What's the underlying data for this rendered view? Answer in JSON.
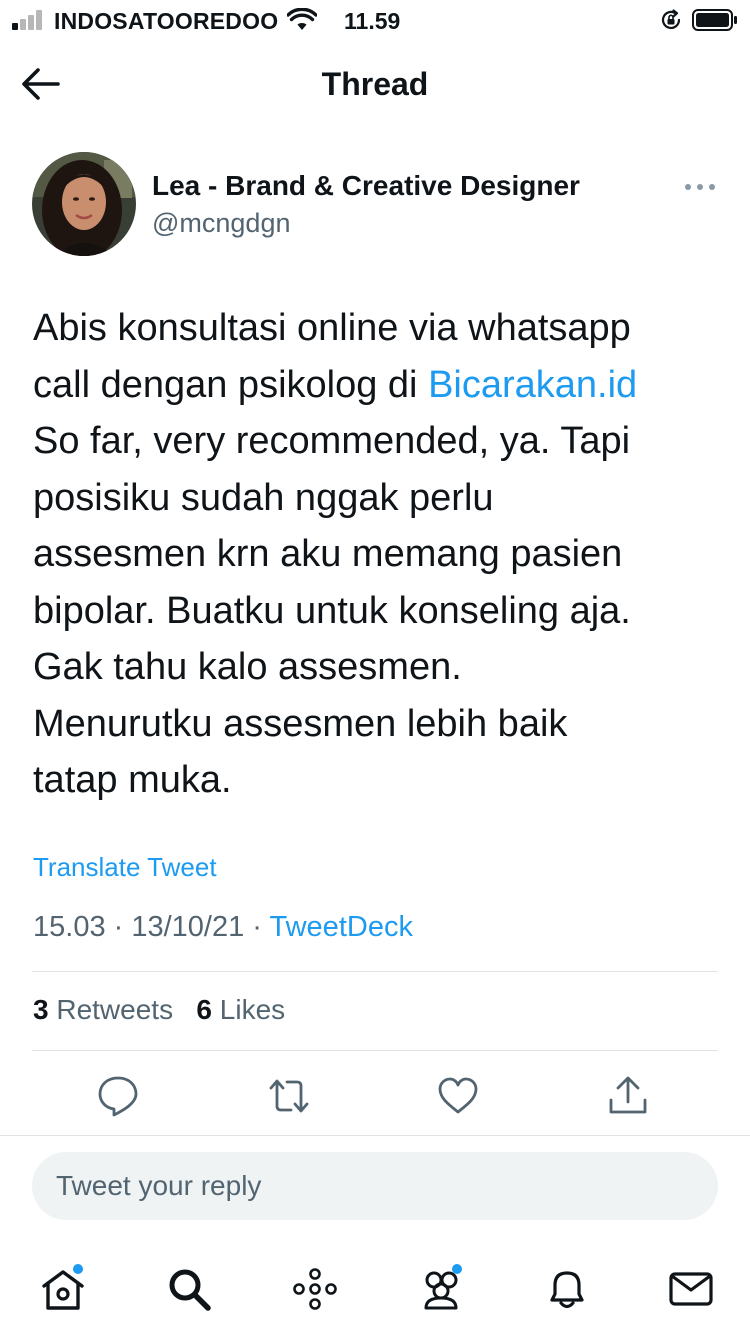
{
  "status_bar": {
    "carrier": "INDOSATOOREDOO",
    "time": "11.59",
    "signal_bars": 4,
    "signal_bars_active": 1,
    "icons": [
      "signal-icon",
      "wifi-icon",
      "rotation-lock-icon",
      "battery-icon"
    ]
  },
  "header": {
    "title": "Thread",
    "back_icon": "arrow-left-icon"
  },
  "tweet": {
    "author_name": "Lea - Brand & Creative Designer",
    "author_handle": "@mcngdgn",
    "text_lines": {
      "l1": "Abis konsultasi online via whatsapp",
      "l2_before": "call dengan psikolog di ",
      "l2_link": "Bicarakan.id",
      "l3": "So far, very recommended, ya. Tapi",
      "l4": "posisiku sudah nggak perlu",
      "l5": "assesmen krn aku memang pasien",
      "l6": "bipolar. Buatku untuk konseling aja.",
      "l7": "Gak tahu kalo assesmen.",
      "l8": "Menurutku assesmen lebih baik",
      "l9": "tatap muka."
    },
    "translate_label": "Translate Tweet",
    "time": "15.03",
    "date": "13/10/21",
    "separator": " · ",
    "source": "TweetDeck"
  },
  "stats": {
    "retweets_count": "3",
    "retweets_label": " Retweets",
    "likes_count": "6",
    "likes_label": " Likes"
  },
  "actions": [
    "reply-icon",
    "retweet-icon",
    "like-icon",
    "share-icon"
  ],
  "reply": {
    "placeholder": "Tweet your reply"
  },
  "bottom_nav": {
    "items": [
      "home-icon",
      "search-icon",
      "spaces-icon",
      "communities-icon",
      "notifications-icon",
      "messages-icon"
    ],
    "notification_dots": [
      "home",
      "communities"
    ]
  },
  "colors": {
    "accent": "#1d9bf0",
    "text": "#0f1419",
    "secondary": "#536471",
    "reply_bg": "#eff3f4",
    "divider": "#dfe3e6"
  }
}
